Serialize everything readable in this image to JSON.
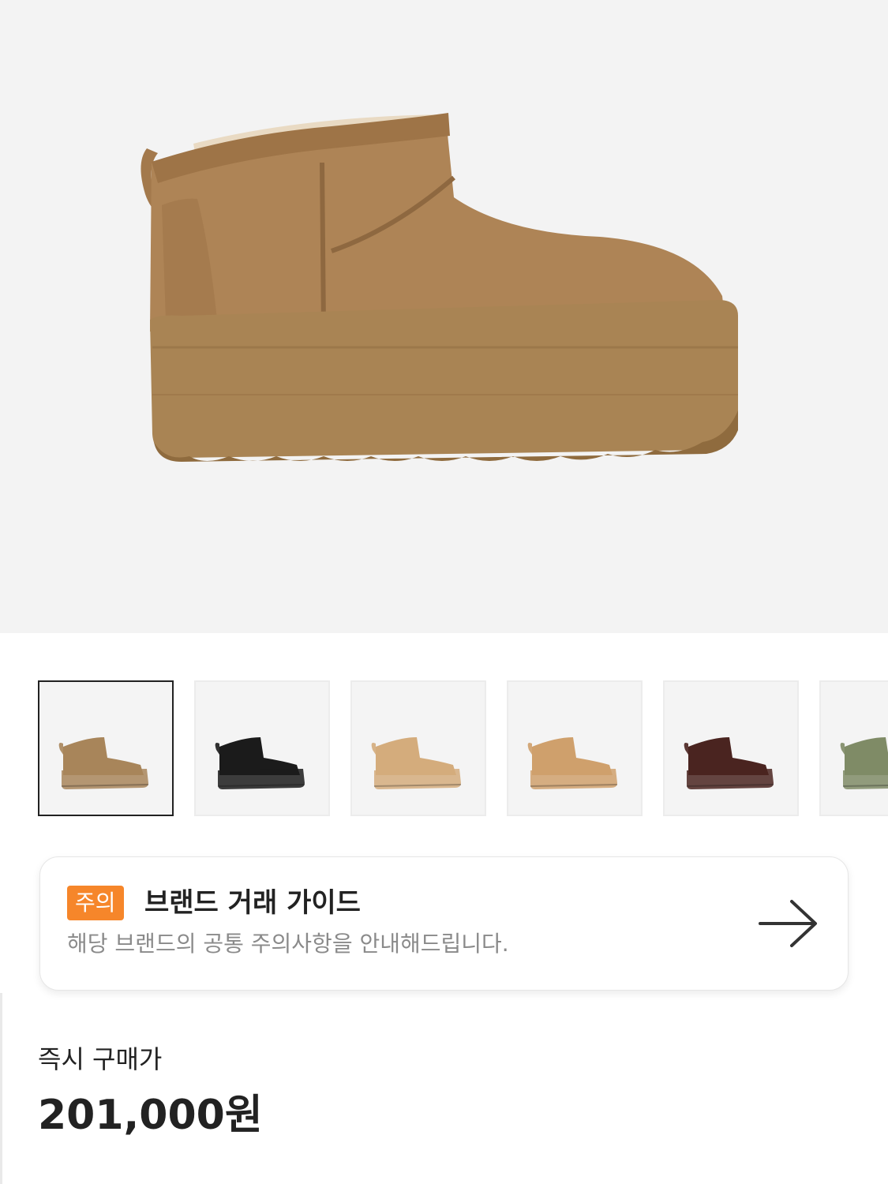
{
  "product": {
    "main_image_icon": "platform-mini-boot-chestnut"
  },
  "thumbnails": [
    {
      "icon": "boot-chestnut-thumb",
      "color": "#a8855a",
      "active": true
    },
    {
      "icon": "boot-black-thumb",
      "color": "#1b1b1b",
      "active": false
    },
    {
      "icon": "boot-sand-thumb",
      "color": "#d4ac7c",
      "active": false
    },
    {
      "icon": "boot-tan-thumb",
      "color": "#cfa06c",
      "active": false
    },
    {
      "icon": "boot-brown-thumb",
      "color": "#4a2420",
      "active": false
    },
    {
      "icon": "boot-olive-thumb",
      "color": "#7f8b66",
      "active": false
    }
  ],
  "guide": {
    "badge": "주의",
    "title": "브랜드 거래 가이드",
    "description": "해당 브랜드의 공통 주의사항을 안내해드립니다.",
    "arrow_icon": "arrow-right-icon"
  },
  "price": {
    "label": "즉시 구매가",
    "value": "201,000원"
  },
  "colors": {
    "badge": "#f6862a",
    "hero_bg": "#f3f3f3"
  }
}
